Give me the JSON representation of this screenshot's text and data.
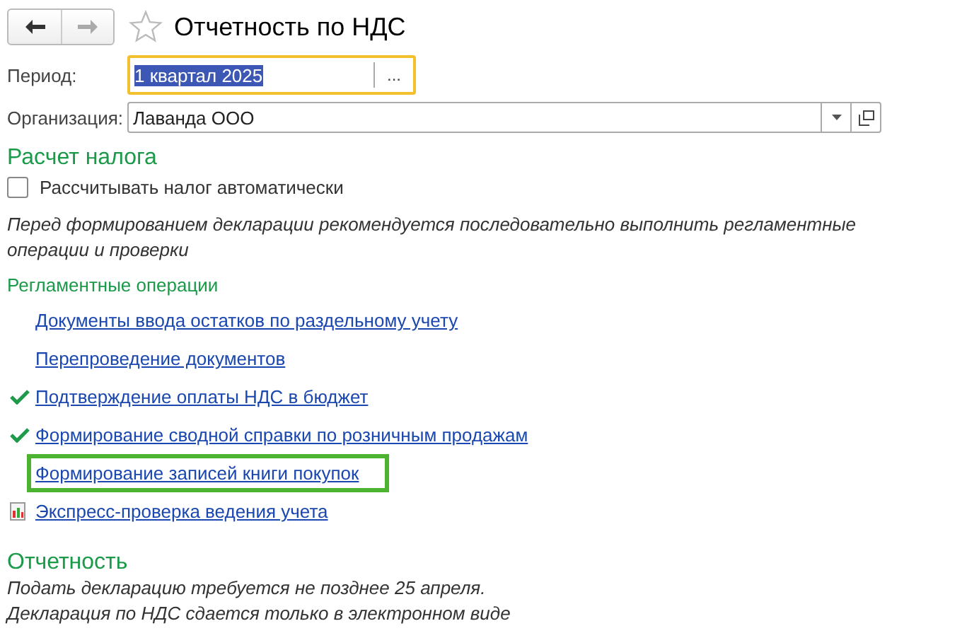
{
  "window": {
    "title": "Отчетность по НДС",
    "favorite": false
  },
  "period": {
    "label": "Период:",
    "value": "1 квартал 2025",
    "focused": true,
    "button": "..."
  },
  "organization": {
    "label": "Организация:",
    "value": "Лаванда ООО"
  },
  "tax_section": {
    "title": "Расчет налога",
    "checkbox": {
      "label": "Рассчитывать налог автоматически",
      "checked": false
    },
    "note": "Перед формированием декларации рекомендуется последовательно выполнить регламентные операции и проверки",
    "operations_title": "Регламентные операции",
    "operations": [
      {
        "label": "Документы ввода остатков по раздельному учету",
        "kind": "plain",
        "highlighted": false
      },
      {
        "label": "Перепроведение документов",
        "kind": "plain",
        "highlighted": false
      },
      {
        "label": "Подтверждение оплаты НДС в бюджет",
        "kind": "done",
        "highlighted": false
      },
      {
        "label": "Формирование сводной справки по розничным продажам",
        "kind": "done",
        "highlighted": false
      },
      {
        "label": "Формирование записей книги покупок",
        "kind": "plain",
        "highlighted": true
      },
      {
        "label": "Экспресс-проверка ведения учета",
        "kind": "report",
        "highlighted": false
      }
    ]
  },
  "reporting": {
    "title": "Отчетность",
    "lines": [
      "Подать декларацию требуется не позднее 25 апреля.",
      "Декларация по НДС сдается только в электронном виде"
    ]
  }
}
